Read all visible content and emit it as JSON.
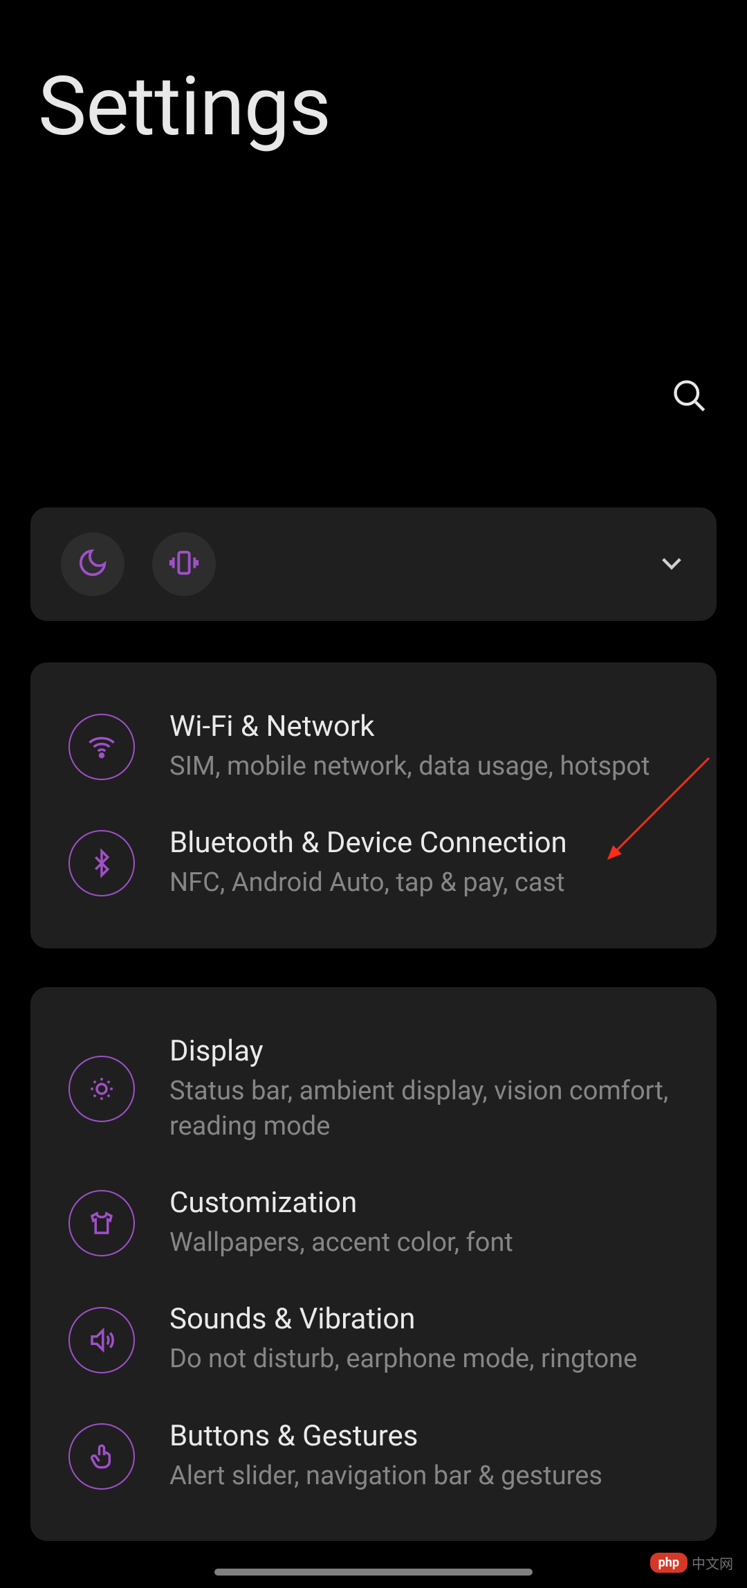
{
  "header": {
    "title": "Settings"
  },
  "quickToggles": {
    "icons": [
      "moon-icon",
      "vibrate-icon"
    ]
  },
  "groups": [
    {
      "items": [
        {
          "id": "wifi",
          "title": "Wi-Fi & Network",
          "subtitle": "SIM, mobile network, data usage, hotspot",
          "icon": "wifi-icon"
        },
        {
          "id": "bluetooth",
          "title": "Bluetooth & Device Connection",
          "subtitle": "NFC, Android Auto, tap & pay, cast",
          "icon": "bluetooth-icon"
        }
      ]
    },
    {
      "items": [
        {
          "id": "display",
          "title": "Display",
          "subtitle": "Status bar, ambient display, vision comfort, reading mode",
          "icon": "brightness-icon"
        },
        {
          "id": "customization",
          "title": "Customization",
          "subtitle": "Wallpapers, accent color, font",
          "icon": "shirt-icon"
        },
        {
          "id": "sounds",
          "title": "Sounds & Vibration",
          "subtitle": "Do not disturb, earphone mode, ringtone",
          "icon": "speaker-icon"
        },
        {
          "id": "buttons",
          "title": "Buttons & Gestures",
          "subtitle": "Alert slider, navigation bar & gestures",
          "icon": "touch-icon"
        }
      ]
    }
  ],
  "watermark": {
    "badge": "php",
    "text": "中文网"
  },
  "colors": {
    "accent": "#a050c8",
    "cardBg": "#1f1f1f",
    "titleText": "#eaeaea",
    "subtitleText": "#868686"
  }
}
